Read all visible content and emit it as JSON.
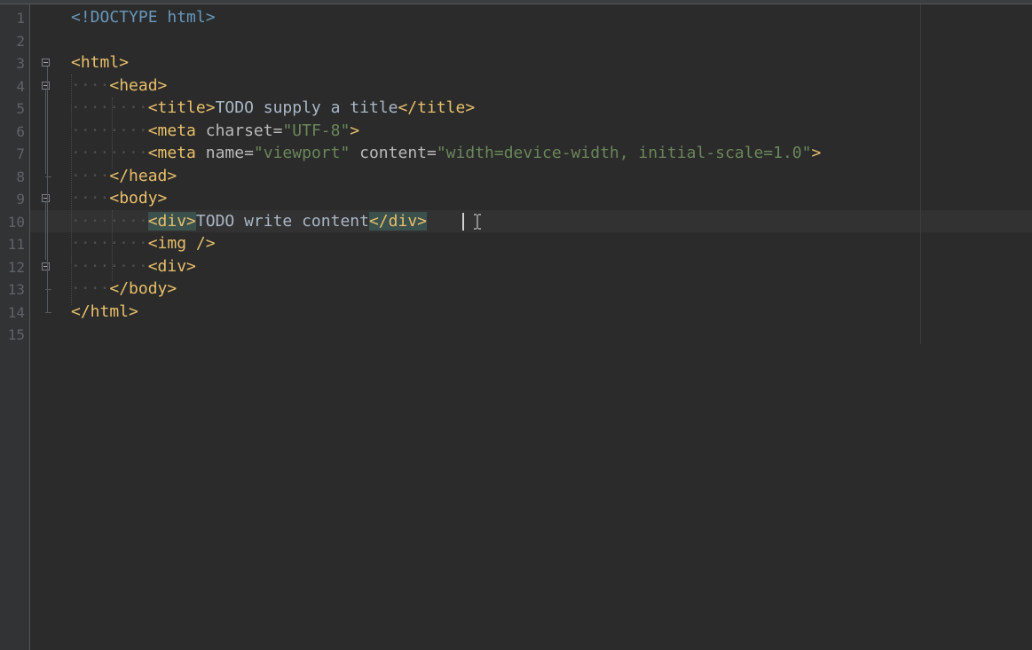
{
  "editor": {
    "language": "HTML",
    "cursor_line": 10,
    "line_numbers": [
      "1",
      "2",
      "3",
      "4",
      "5",
      "6",
      "7",
      "8",
      "9",
      "10",
      "11",
      "12",
      "13",
      "14",
      "15"
    ],
    "lines": {
      "l1": {
        "doctype": "<!DOCTYPE html>"
      },
      "l3": {
        "html_open": "<html>"
      },
      "l4": {
        "indent": "····",
        "head_open": "<head>"
      },
      "l5": {
        "indent": "········",
        "title_open": "<title>",
        "text": "TODO supply a title",
        "title_close": "</title>"
      },
      "l6": {
        "indent": "········",
        "meta": "<meta",
        "attr_charset": " charset=",
        "charset_value": "\"UTF-8\"",
        "close": ">"
      },
      "l7": {
        "indent": "········",
        "meta": "<meta",
        "attr_name": " name=",
        "name_value": "\"viewport\"",
        "attr_content": " content=",
        "content_value": "\"width=device-width, initial-scale=1.0\"",
        "close": ">"
      },
      "l8": {
        "indent": "····",
        "head_close": "</head>"
      },
      "l9": {
        "indent": "····",
        "body_open": "<body>"
      },
      "l10": {
        "indent": "········",
        "div_open": "<div>",
        "text": "TODO write content",
        "div_close": "</div>"
      },
      "l11": {
        "indent": "········",
        "img": "<img />"
      },
      "l12": {
        "indent": "········",
        "div_open": "<div>"
      },
      "l13": {
        "indent": "····",
        "body_close": "</body>"
      },
      "l14": {
        "html_close": "</html>"
      }
    }
  },
  "colors": {
    "background": "#2b2b2b",
    "gutter": "#313335",
    "line_number": "#606366",
    "tag": "#e8bf6a",
    "doctype": "#6897bb",
    "attribute": "#bababa",
    "string": "#6a8759",
    "text": "#a9b7c6",
    "tag_match_highlight": "#3b514d",
    "current_line": "#323232"
  },
  "icons": {
    "fold": "fold-collapse-icon",
    "mouse_cursor": "i-beam-cursor-icon"
  }
}
